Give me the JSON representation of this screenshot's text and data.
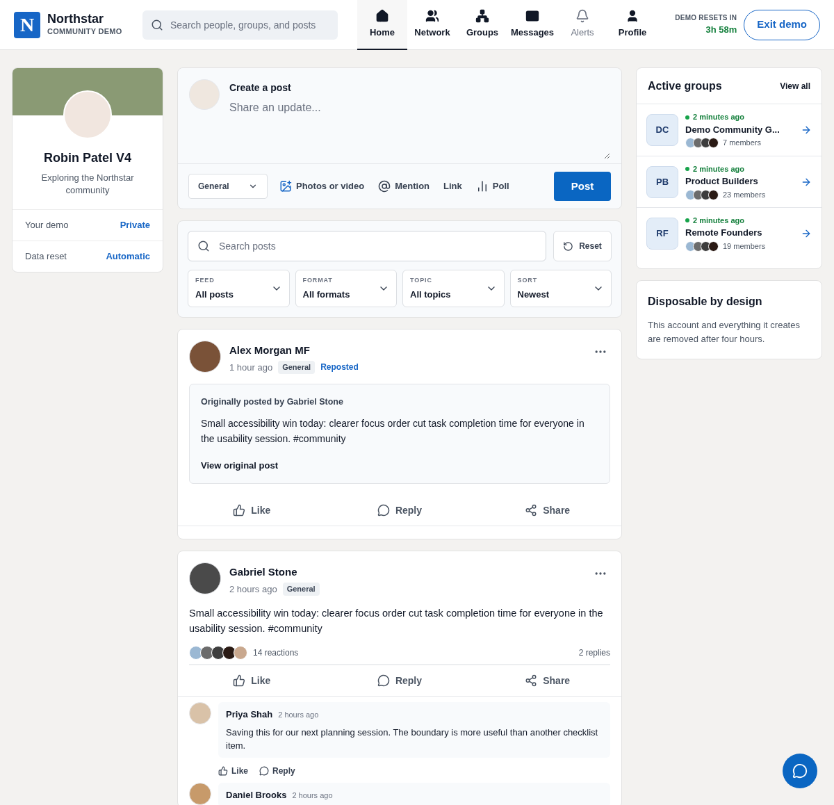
{
  "header": {
    "logo_letter": "N",
    "brand": "Northstar",
    "subtitle": "COMMUNITY DEMO",
    "search_placeholder": "Search people, groups, and posts",
    "nav": [
      {
        "label": "Home",
        "kind": "home",
        "selected": true,
        "disabled": false
      },
      {
        "label": "Network",
        "kind": "network",
        "selected": false,
        "disabled": false
      },
      {
        "label": "Groups",
        "kind": "groups",
        "selected": false,
        "disabled": false
      },
      {
        "label": "Messages",
        "kind": "messages",
        "selected": false,
        "disabled": false
      },
      {
        "label": "Alerts",
        "kind": "alerts",
        "selected": false,
        "disabled": true
      },
      {
        "label": "Profile",
        "kind": "profile",
        "selected": false,
        "disabled": false
      }
    ],
    "reset_label": "DEMO RESETS IN",
    "reset_time": "3h 58m",
    "exit_button": "Exit demo"
  },
  "profile": {
    "name": "Robin Patel V4",
    "bio": "Exploring the Northstar community",
    "rows": [
      {
        "label": "Your demo",
        "value": "Private"
      },
      {
        "label": "Data reset",
        "value": "Automatic"
      }
    ]
  },
  "composer": {
    "title": "Create a post",
    "placeholder": "Share an update...",
    "topic": "General",
    "actions": [
      {
        "kind": "photo",
        "label": "Photos or video"
      },
      {
        "kind": "mention",
        "label": "Mention"
      },
      {
        "kind": "link",
        "label": "Link"
      },
      {
        "kind": "poll",
        "label": "Poll"
      }
    ],
    "post_button": "Post"
  },
  "filters": {
    "search_placeholder": "Search posts",
    "reset_button": "Reset",
    "dropdowns": [
      {
        "label": "FEED",
        "value": "All posts"
      },
      {
        "label": "FORMAT",
        "value": "All formats"
      },
      {
        "label": "TOPIC",
        "value": "All topics"
      },
      {
        "label": "SORT",
        "value": "Newest"
      }
    ]
  },
  "posts": [
    {
      "author": "Alex Morgan MF",
      "time": "1 hour ago",
      "tag": "General",
      "reposted_label": "Reposted",
      "repost": {
        "origin": "Originally posted by Gabriel Stone",
        "text": "Small accessibility win today: clearer focus order cut task completion time for everyone in the usability session. #community",
        "link": "View original post"
      },
      "actions": [
        {
          "kind": "like",
          "label": "Like"
        },
        {
          "kind": "reply",
          "label": "Reply"
        },
        {
          "kind": "share",
          "label": "Share"
        }
      ]
    },
    {
      "author": "Gabriel Stone",
      "time": "2 hours ago",
      "tag": "General",
      "text": "Small accessibility win today: clearer focus order cut task completion time for everyone in the usability session. #community",
      "reactions": "14 reactions",
      "replies": "2 replies",
      "actions": [
        {
          "kind": "like",
          "label": "Like"
        },
        {
          "kind": "reply",
          "label": "Reply"
        },
        {
          "kind": "share",
          "label": "Share"
        }
      ],
      "comments": [
        {
          "author": "Priya Shah",
          "time": "2 hours ago",
          "text": "Saving this for our next planning session. The boundary is more useful than another checklist item.",
          "actions": [
            {
              "kind": "like",
              "label": "Like"
            },
            {
              "kind": "reply",
              "label": "Reply"
            }
          ]
        },
        {
          "author": "Daniel Brooks",
          "time": "2 hours ago"
        }
      ]
    }
  ],
  "groups_card": {
    "title": "Active groups",
    "view_all": "View all",
    "groups": [
      {
        "initials": "DC",
        "activity": "2 minutes ago",
        "name": "Demo Community G...",
        "members": "7 members"
      },
      {
        "initials": "PB",
        "activity": "2 minutes ago",
        "name": "Product Builders",
        "members": "23 members"
      },
      {
        "initials": "RF",
        "activity": "2 minutes ago",
        "name": "Remote Founders",
        "members": "19 members"
      }
    ]
  },
  "info_card": {
    "title": "Disposable by design",
    "text": "This account and everything it creates are removed after four hours."
  }
}
